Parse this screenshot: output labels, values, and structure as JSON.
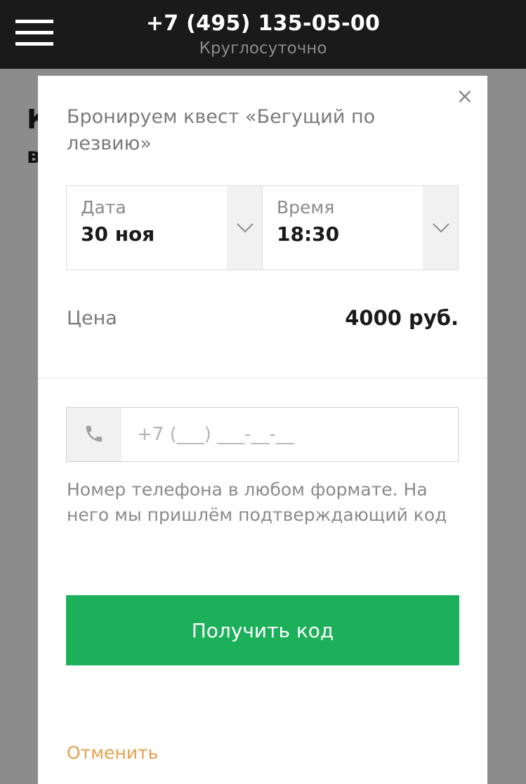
{
  "header": {
    "phone": "+7 (495) 135-05-00",
    "hours": "Круглосуточно"
  },
  "modal": {
    "title": "Бронируем квест «Бегущий по лезвию»",
    "close_symbol": "×",
    "date": {
      "label": "Дата",
      "value": "30 ноя"
    },
    "time": {
      "label": "Время",
      "value": "18:30"
    },
    "price": {
      "label": "Цена",
      "value": "4000 руб."
    },
    "phone_input": {
      "placeholder": "+7 (___) ___-__-__",
      "value": ""
    },
    "hint": "Номер телефона в любом формате. На него мы пришлём подтверждающий код",
    "submit_label": "Получить код",
    "cancel_label": "Отменить"
  },
  "icons": {
    "menu": "hamburger-menu-icon",
    "close": "close-icon",
    "dropdown": "chevron-down-icon",
    "phone": "phone-handset-icon"
  },
  "colors": {
    "header_bg": "#1a1a1a",
    "cta_green": "#1db05a",
    "cancel_orange": "#e6a04a"
  }
}
